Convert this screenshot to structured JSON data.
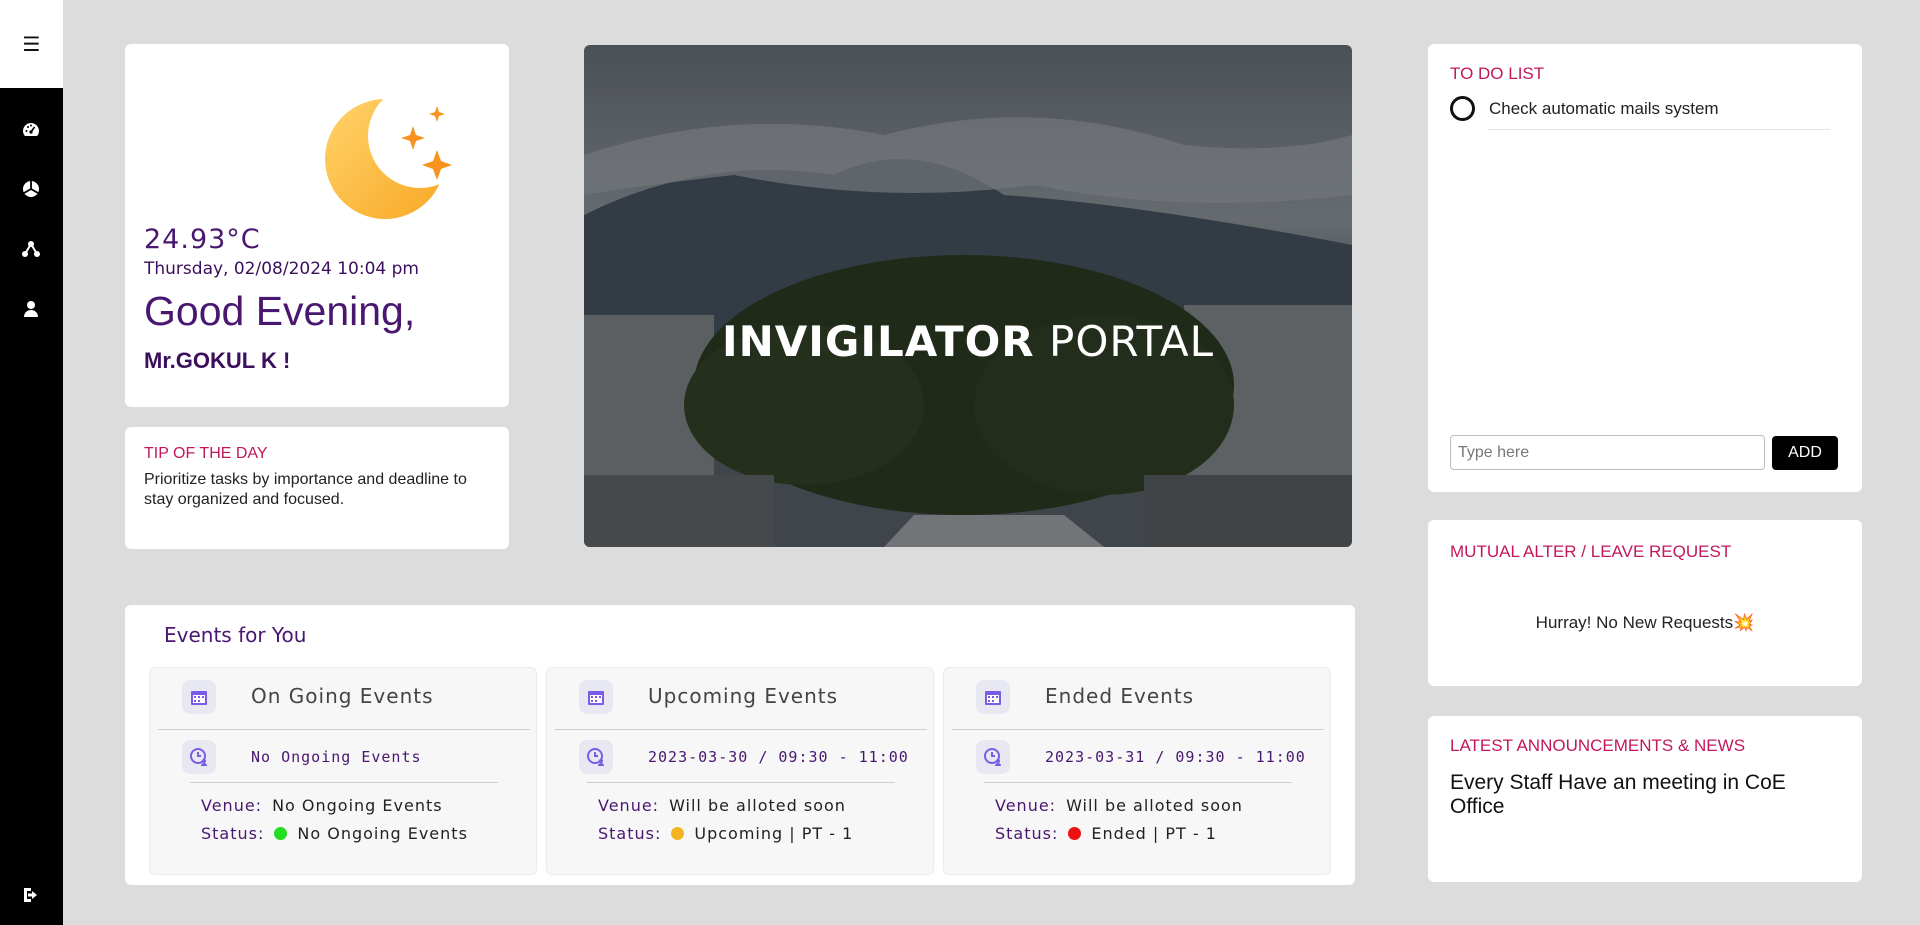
{
  "sidebar": {
    "menu_icon": "hamburger-icon",
    "items": [
      {
        "icon": "dashboard-icon"
      },
      {
        "icon": "pie-chart-icon"
      },
      {
        "icon": "network-icon"
      },
      {
        "icon": "user-icon"
      }
    ],
    "logout_icon": "logout-icon"
  },
  "weather": {
    "icon": "moon-stars-icon",
    "temperature": "24.93°C",
    "datetime": "Thursday, 02/08/2024 10:04 pm",
    "greeting": "Good Evening,",
    "user": "Mr.GOKUL K !"
  },
  "tip": {
    "title": "TIP OF THE DAY",
    "text": "Prioritize tasks by importance and deadline to stay organized and focused."
  },
  "banner": {
    "title_bold": "INVIGILATOR",
    "title_light": " PORTAL"
  },
  "events": {
    "title": "Events for You",
    "columns": [
      {
        "heading": "On Going Events",
        "datetime": "No Ongoing Events",
        "venue_label": "Venue:",
        "venue": "No Ongoing Events",
        "status_label": "Status:",
        "status": "No Ongoing Events",
        "status_color": "#22dd22"
      },
      {
        "heading": "Upcoming Events",
        "datetime": "2023-03-30 / 09:30 - 11:00",
        "venue_label": "Venue:",
        "venue": "Will be alloted soon",
        "status_label": "Status:",
        "status": "Upcoming | PT - 1",
        "status_color": "#f2b51f"
      },
      {
        "heading": "Ended Events",
        "datetime": "2023-03-31 / 09:30 - 11:00",
        "venue_label": "Venue:",
        "venue": "Will be alloted soon",
        "status_label": "Status:",
        "status": "Ended | PT - 1",
        "status_color": "#ee1111"
      }
    ]
  },
  "todo": {
    "title": "TO DO LIST",
    "items": [
      {
        "text": "Check automatic mails system"
      }
    ],
    "input_placeholder": "Type here",
    "add_label": "ADD"
  },
  "mutual": {
    "title": "MUTUAL ALTER / LEAVE REQUEST",
    "message": "Hurray! No New Requests💥"
  },
  "news": {
    "title": "LATEST ANNOUNCEMENTS & NEWS",
    "text": "Every Staff Have an meeting in CoE Office"
  },
  "colors": {
    "accent_pink": "#c2185b",
    "accent_purple": "#4a1770",
    "sidebar_bg": "#000000"
  }
}
